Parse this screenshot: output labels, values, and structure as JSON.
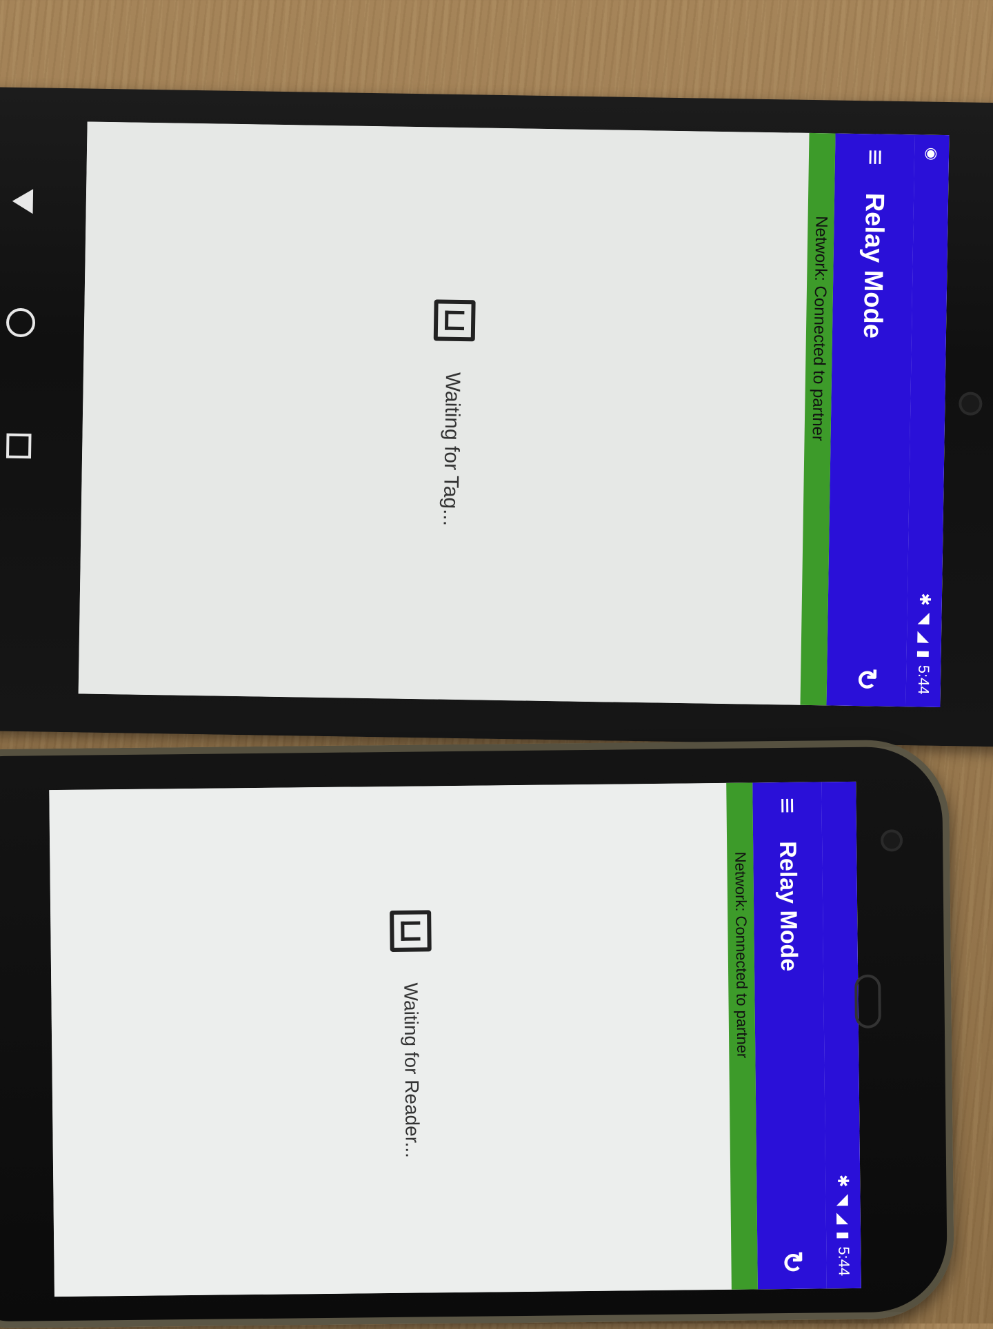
{
  "top_phone": {
    "status_time": "5:44",
    "app_title": "Relay Mode",
    "network_status": "Network: Connected to partner",
    "waiting_text": "Waiting for Tag...",
    "icons": [
      "menu-icon",
      "refresh-icon",
      "bluetooth-icon",
      "wifi-icon",
      "signal-icon",
      "battery-icon",
      "nfc-icon",
      "back-icon",
      "home-icon",
      "recents-icon"
    ]
  },
  "bottom_phone": {
    "status_time": "5:44",
    "app_title": "Relay Mode",
    "network_status": "Network: Connected to partner",
    "waiting_text": "Waiting for Reader...",
    "icons": [
      "menu-icon",
      "refresh-icon",
      "bluetooth-icon",
      "wifi-icon",
      "signal-icon",
      "battery-icon",
      "nfc-icon"
    ]
  },
  "colors": {
    "app_bar": "#2a10d8",
    "network_bar": "#3d9b2a",
    "screen_background": "#e6e8e6"
  }
}
